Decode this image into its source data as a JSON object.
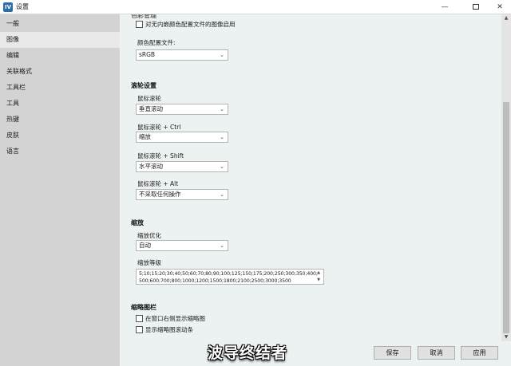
{
  "window": {
    "title": "设置",
    "app_icon": "app-icon",
    "minimize_glyph": "—",
    "close_glyph": "✕"
  },
  "sidebar": {
    "items": [
      {
        "label": "一般",
        "active": false
      },
      {
        "label": "图像",
        "active": true
      },
      {
        "label": "编辑",
        "active": false
      },
      {
        "label": "关联格式",
        "active": false
      },
      {
        "label": "工具栏",
        "active": false
      },
      {
        "label": "工具",
        "active": false
      },
      {
        "label": "热键",
        "active": false
      },
      {
        "label": "皮肤",
        "active": false
      },
      {
        "label": "语言",
        "active": false
      }
    ]
  },
  "image_settings": {
    "embedded_profile_checkbox": {
      "label": "对无内嵌颜色配置文件的图像启用",
      "checked": false
    },
    "color_profile": {
      "label": "颜色配置文件:",
      "value": "sRGB"
    }
  },
  "wheel_settings": {
    "title": "滚轮设置",
    "fields": [
      {
        "label": "鼠标滚轮",
        "value": "垂直滚动"
      },
      {
        "label": "鼠标滚轮 + Ctrl",
        "value": "缩放"
      },
      {
        "label": "鼠标滚轮 + Shift",
        "value": "水平滚动"
      },
      {
        "label": "鼠标滚轮 + Alt",
        "value": "不采取任何操作"
      }
    ]
  },
  "zoom": {
    "title": "缩放",
    "optimization": {
      "label": "缩放优化",
      "value": "自动"
    },
    "levels": {
      "label": "缩放等级",
      "line1": "5;10;15;20;30;40;50;60;70;80;90;100;125;150;175;200;250;300;350;400;",
      "line2": "500;600;700;800;1000;1200;1500;1800;2100;2500;3000;3500"
    }
  },
  "thumbnail_bar": {
    "title": "缩略图栏",
    "checkboxes": [
      {
        "label": "在窗口右侧显示缩略图",
        "checked": false
      },
      {
        "label": "显示缩略图滚动条",
        "checked": false
      }
    ]
  },
  "footer": {
    "save": "保存",
    "cancel": "取消",
    "apply": "应用",
    "watermark": "波导终结者"
  },
  "colors": {
    "sidebar_bg": "#d3d3d3",
    "sidebar_active": "#e9e9e9",
    "content_bg": "#ecf1f1",
    "button_bg": "#e1e1e1"
  }
}
